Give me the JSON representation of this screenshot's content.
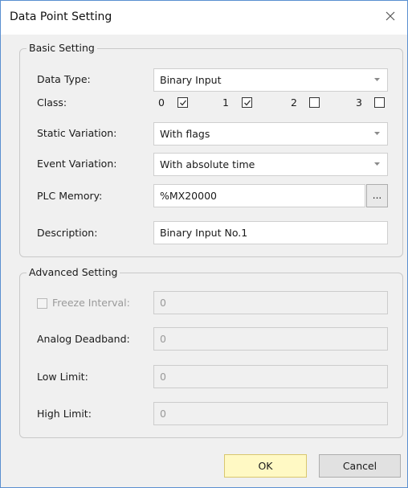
{
  "window": {
    "title": "Data Point Setting"
  },
  "basic": {
    "group_title": "Basic Setting",
    "data_type_label": "Data Type:",
    "data_type_value": "Binary Input",
    "class_label": "Class:",
    "classes": [
      {
        "label": "0",
        "checked": true
      },
      {
        "label": "1",
        "checked": true
      },
      {
        "label": "2",
        "checked": false
      },
      {
        "label": "3",
        "checked": false
      }
    ],
    "static_variation_label": "Static Variation:",
    "static_variation_value": "With flags",
    "event_variation_label": "Event Variation:",
    "event_variation_value": "With absolute time",
    "plc_memory_label": "PLC Memory:",
    "plc_memory_value": "%MX20000",
    "browse_label": "...",
    "description_label": "Description:",
    "description_value": "Binary Input No.1"
  },
  "advanced": {
    "group_title": "Advanced Setting",
    "freeze_interval_label": "Freeze Interval:",
    "freeze_interval_checked": false,
    "freeze_interval_value": "0",
    "analog_deadband_label": "Analog Deadband:",
    "analog_deadband_value": "0",
    "low_limit_label": "Low Limit:",
    "low_limit_value": "0",
    "high_limit_label": "High Limit:",
    "high_limit_value": "0"
  },
  "buttons": {
    "ok": "OK",
    "cancel": "Cancel"
  }
}
